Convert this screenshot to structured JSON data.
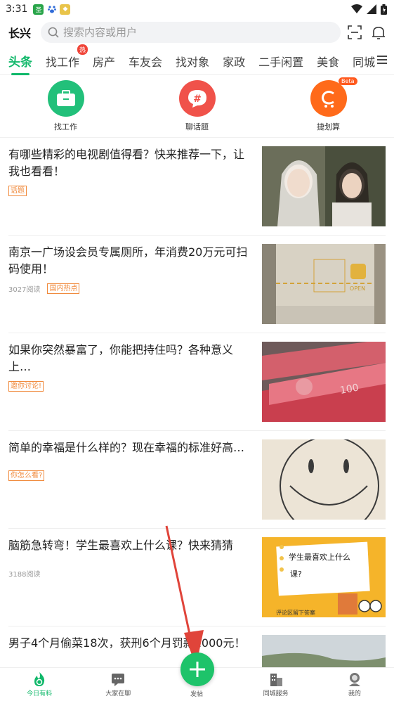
{
  "status_bar": {
    "time": "3:31"
  },
  "header": {
    "city": "长兴",
    "search_placeholder": "搜索内容或用户"
  },
  "tabs": [
    {
      "label": "头条",
      "active": true
    },
    {
      "label": "找工作",
      "badge": "热"
    },
    {
      "label": "房产"
    },
    {
      "label": "车友会"
    },
    {
      "label": "找对象"
    },
    {
      "label": "家政"
    },
    {
      "label": "二手闲置"
    },
    {
      "label": "美食"
    },
    {
      "label": "同城"
    }
  ],
  "quick_entries": [
    {
      "label": "找工作",
      "color": "#22c07a"
    },
    {
      "label": "聊话题",
      "color": "#f0524a"
    },
    {
      "label": "捷划算",
      "color": "#ff6a1a",
      "badge": "Beta"
    }
  ],
  "feed": [
    {
      "title": "有哪些精彩的电视剧值得看？快来推荐一下，让我也看看！",
      "reads": "",
      "tag": "话题"
    },
    {
      "title": "南京一广场设会员专属厕所，年消费20万元可扫码使用！",
      "reads": "3027阅读",
      "tag": "国内热点"
    },
    {
      "title": "如果你突然暴富了，你能把持住吗？各种意义上…",
      "reads": "",
      "tag": "邀你讨论!"
    },
    {
      "title": "简单的幸福是什么样的？现在幸福的标准好高…",
      "reads": "",
      "tag": "你怎么看?"
    },
    {
      "title": "脑筋急转弯！学生最喜欢上什么课？快来猜猜",
      "reads": "3188阅读",
      "tag": ""
    },
    {
      "title": "男子4个月偷菜18次，获刑6个月罚款1000元！",
      "reads": "",
      "tag": ""
    }
  ],
  "thumb_texts": {
    "open_sign": "OPEN",
    "banknote": "100",
    "quiz_line1": "学生最喜欢上什么",
    "quiz_line2": "课?",
    "quiz_footer": "评论区留下答案"
  },
  "bottom_nav": [
    {
      "label": "今日有料",
      "active": true
    },
    {
      "label": "大家在聊"
    },
    {
      "label": "发帖"
    },
    {
      "label": "同城服务"
    },
    {
      "label": "我的"
    }
  ],
  "colors": {
    "accent": "#10b86a",
    "tag": "#f08a3c",
    "annotation_arrow": "#e0443a"
  }
}
